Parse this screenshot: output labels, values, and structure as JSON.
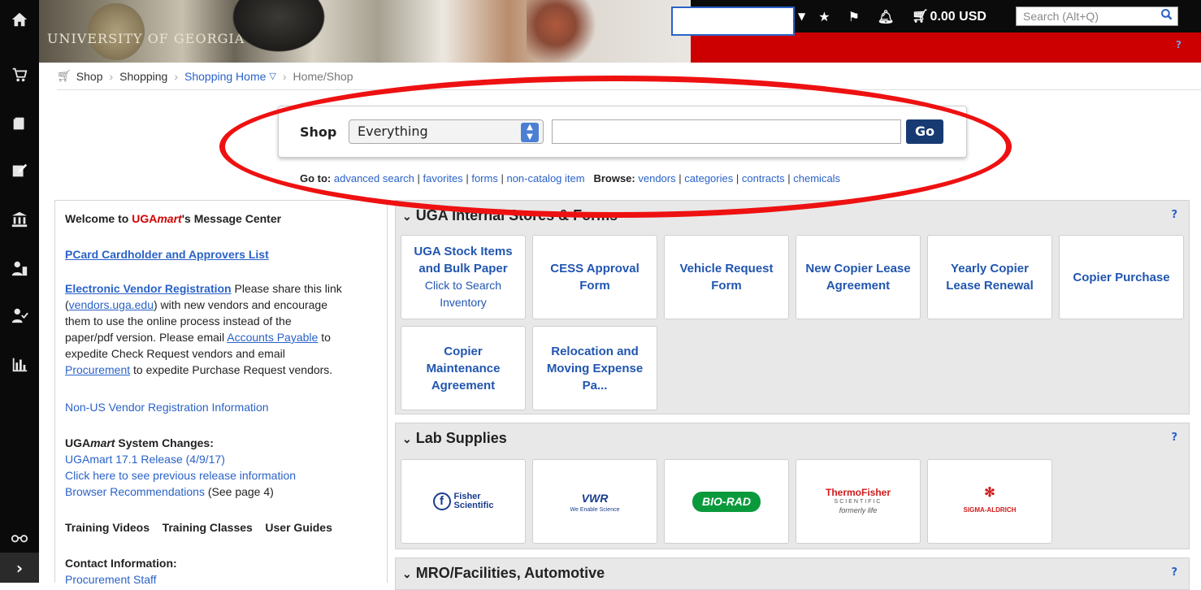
{
  "top_bar": {
    "cart_total": "0.00 USD",
    "search_placeholder": "Search (Alt+Q)",
    "help": "?",
    "banner_text": "UNIVERSITY OF GEORGIA"
  },
  "breadcrumb": {
    "items": [
      "Shop",
      "Shopping",
      "Shopping Home",
      "Home/Shop"
    ]
  },
  "shop_box": {
    "label": "Shop",
    "category_selected": "Everything",
    "go_label": "Go"
  },
  "goto": {
    "label": "Go to:",
    "links": [
      "advanced search",
      "favorites",
      "forms",
      "non-catalog item"
    ],
    "browse_label": "Browse:",
    "browse_links": [
      "vendors",
      "categories",
      "contracts",
      "chemicals"
    ]
  },
  "message_center": {
    "title_pre": "Welcome to ",
    "title_brand1": "UGA",
    "title_brand2": "mart",
    "title_post": "'s Message Center",
    "pcard_link": "PCard Cardholder and Approvers List",
    "evr_link": "Electronic Vendor Registration",
    "evr_text1": " Please share this link",
    "evr_paren_open": "(",
    "vendors_link": "vendors.uga.edu",
    "evr_text2": ") with new vendors and encourage",
    "evr_text3": "them to use the online process instead of the",
    "evr_text4": "paper/pdf version. Please email ",
    "ap_link": "Accounts Payable",
    "evr_text4b": " to",
    "evr_text5": "expedite Check Request vendors and email",
    "procurement_link": "Procurement",
    "evr_text6": " to expedite Purchase Request vendors.",
    "nonus_link": "Non-US Vendor Registration Information",
    "sys_title_pre": "UGA",
    "sys_title_em": "mart",
    "sys_title_post": " System Changes:",
    "release_link": "UGAmart 17.1 Release",
    "release_date": "(4/9/17)",
    "prev_release_link": "Click here to see previous release information",
    "browser_link": "Browser Recommendations",
    "browser_note": " (See page 4)",
    "training_videos": "Training Videos",
    "training_classes": "Training Classes",
    "user_guides": "User Guides",
    "contact_title": "Contact Information:",
    "procurement_staff": "Procurement Staff"
  },
  "sections": [
    {
      "title": "UGA Internal Stores & Forms",
      "help": "?",
      "tiles": [
        {
          "title": "UGA Stock Items and Bulk Paper",
          "sub": "Click to Search Inventory"
        },
        {
          "title": "CESS Approval Form",
          "sub": ""
        },
        {
          "title": "Vehicle Request Form",
          "sub": ""
        },
        {
          "title": "New Copier Lease Agreement",
          "sub": ""
        },
        {
          "title": "Yearly Copier Lease Renewal",
          "sub": ""
        },
        {
          "title": "Copier Purchase",
          "sub": ""
        },
        {
          "title": "Copier Maintenance Agreement",
          "sub": ""
        },
        {
          "title": "Relocation and Moving Expense Pa...",
          "sub": ""
        }
      ]
    },
    {
      "title": "Lab Supplies",
      "help": "?",
      "vendors": [
        "Fisher Scientific",
        "VWR",
        "BIO-RAD",
        "ThermoFisher Scientific formerly life",
        "SIGMA-ALDRICH"
      ]
    },
    {
      "title": "MRO/Facilities, Automotive",
      "help": "?"
    }
  ],
  "vendor_logo_text": {
    "fisher1": "Fisher",
    "fisher2": "Scientific",
    "vwr": "VWR",
    "vwr_tag": "We Enable Science",
    "biorad": "BIO-RAD",
    "thermo1": "ThermoFisher",
    "thermo2": "SCIENTIFIC",
    "thermo3": "formerly life",
    "sigma": "SIGMA-ALDRICH"
  },
  "icons": [
    "home-icon",
    "cart-icon",
    "documents-icon",
    "edit-icon",
    "bank-icon",
    "users-icon",
    "approvals-icon",
    "reports-icon",
    "binoculars-icon",
    "expand-icon",
    "star-icon",
    "flag-icon",
    "bell-icon",
    "search-icon"
  ],
  "colors": {
    "brand_red": "#cc0000",
    "link_blue": "#2a62c8",
    "go_button": "#173a72",
    "highlight_oval": "#ee1111"
  }
}
